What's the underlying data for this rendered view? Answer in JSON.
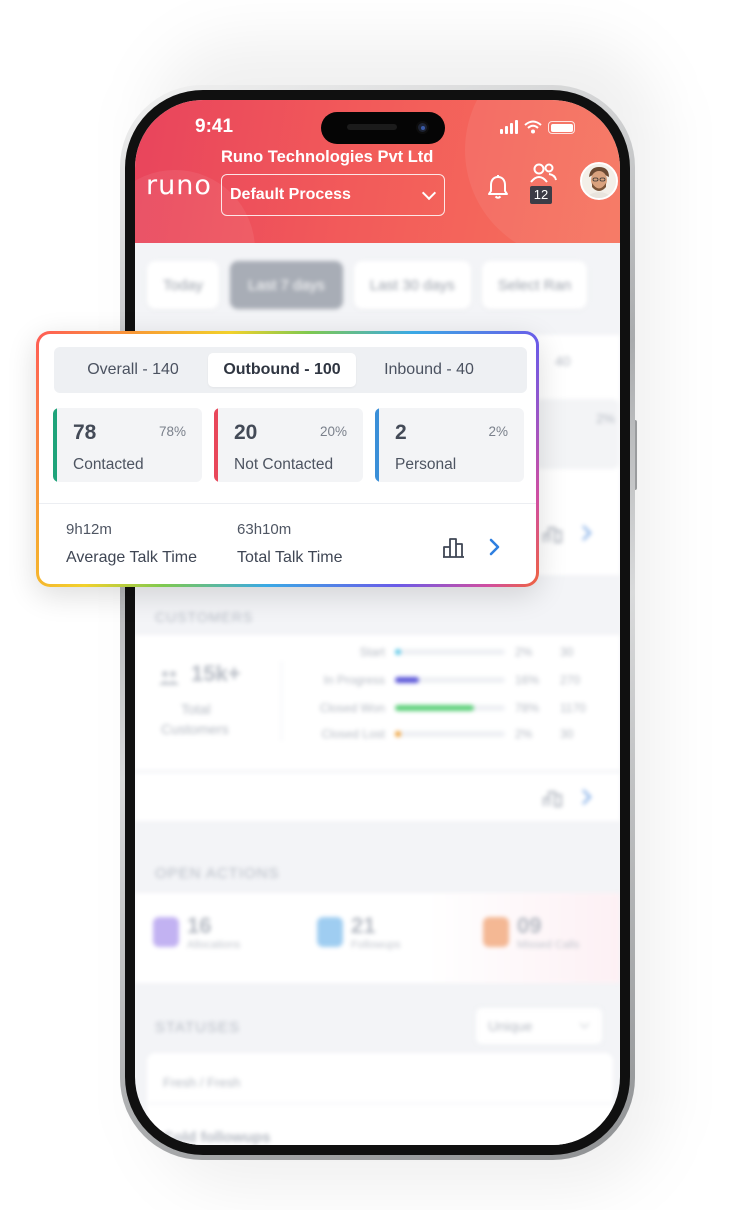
{
  "status_bar": {
    "time": "9:41"
  },
  "header": {
    "logo": "runo",
    "company": "Runo Technologies Pvt Ltd",
    "process_select": "Default Process",
    "team_count": "12",
    "icons": [
      "bell-icon",
      "team-icon",
      "avatar"
    ]
  },
  "date_filters": [
    "Today",
    "Last 7 days",
    "Last 30 days",
    "Select Ran"
  ],
  "overlay": {
    "tabs": [
      "Overall - 140",
      "Outbound - 100",
      "Inbound - 40"
    ],
    "active_tab": "Outbound - 100",
    "stats": [
      {
        "value": "78",
        "percent": "78%",
        "label": "Contacted",
        "color": "#1fa37a"
      },
      {
        "value": "20",
        "percent": "20%",
        "label": "Not Contacted",
        "color": "#e8475a"
      },
      {
        "value": "2",
        "percent": "2%",
        "label": "Personal",
        "color": "#3a8fd8"
      }
    ],
    "talk_time": {
      "average": {
        "hours": "9",
        "minutes": "12",
        "label": "Average Talk Time"
      },
      "total": {
        "hours": "63",
        "minutes": "10",
        "label": "Total Talk Time"
      },
      "h_unit": "h",
      "m_unit": "m"
    }
  },
  "background": {
    "tab_hint": "40",
    "stat_hint_pct": "2%",
    "customers": {
      "title": "CUSTOMERS",
      "total": "15k+",
      "total_label_1": "Total",
      "total_label_2": "Customers",
      "stages": [
        {
          "label": "Start",
          "pct": "2%",
          "count": "30",
          "fill": 0.05,
          "color": "#5bc8e8"
        },
        {
          "label": "In Progress",
          "pct": "16%",
          "count": "270",
          "fill": 0.22,
          "color": "#5a55d8"
        },
        {
          "label": "Closed Won",
          "pct": "78%",
          "count": "1170",
          "fill": 0.72,
          "color": "#5ccf7a"
        },
        {
          "label": "Closed Lost",
          "pct": "2%",
          "count": "30",
          "fill": 0.05,
          "color": "#f0a23a"
        }
      ]
    },
    "open_actions": {
      "title": "OPEN ACTIONS",
      "items": [
        {
          "num": "16",
          "label": "Allocations",
          "color": "#b9a4f0"
        },
        {
          "num": "21",
          "label": "Followups",
          "color": "#8fc6ef"
        },
        {
          "num": "09",
          "label": "Missed Calls",
          "color": "#f2b08c"
        }
      ]
    },
    "statuses": {
      "title": "STATUSES",
      "select": "Unique",
      "row1": "Fresh / Fresh",
      "row2": "Cold followups"
    }
  }
}
